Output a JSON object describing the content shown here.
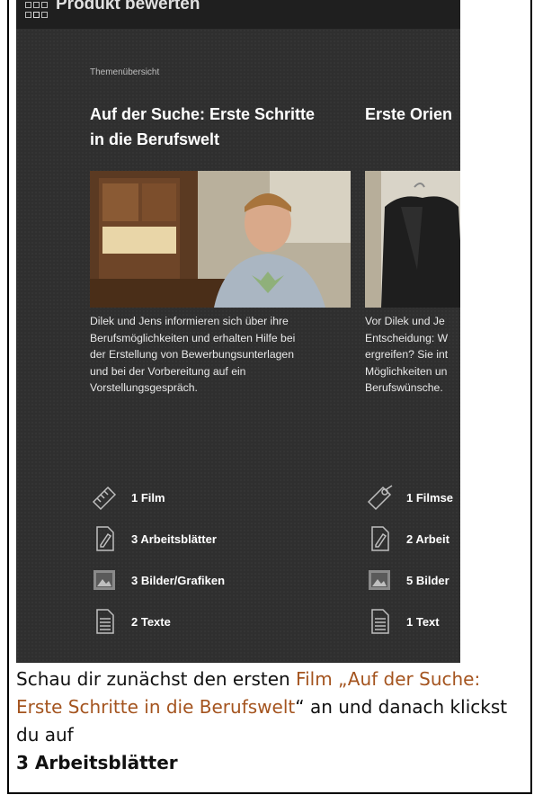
{
  "header": {
    "title": "Produkt bewerten"
  },
  "breadcrumb": "Themenübersicht",
  "columns": [
    {
      "title_line1": "Auf der Suche: Erste Schritte",
      "title_line2": "in die Berufswelt",
      "description_lines": [
        "Dilek und Jens informieren sich über ihre",
        "Berufsmöglichkeiten und erhalten Hilfe bei",
        "der Erstellung von Bewerbungsunterlagen",
        "und bei der Vorbereitung auf ein",
        "Vorstellungsgespräch."
      ],
      "features": [
        {
          "icon": "film-icon",
          "label": "1 Film"
        },
        {
          "icon": "worksheet-icon",
          "label": "3 Arbeitsblätter"
        },
        {
          "icon": "image-icon",
          "label": "3 Bilder/Grafiken"
        },
        {
          "icon": "text-document-icon",
          "label": "2 Texte"
        }
      ]
    },
    {
      "title_line1": "Erste Orien",
      "description_lines": [
        "Vor Dilek und Je",
        "Entscheidung: W",
        "ergreifen? Sie int",
        "Möglichkeiten un",
        "Berufswünsche."
      ],
      "features": [
        {
          "icon": "film-clip-icon",
          "label": "1 Filmse"
        },
        {
          "icon": "worksheet-icon",
          "label": "2 Arbeit"
        },
        {
          "icon": "image-icon",
          "label": "5 Bilder"
        },
        {
          "icon": "text-document-icon",
          "label": "1 Text"
        }
      ]
    }
  ],
  "caption": {
    "part1": "Schau dir zunächst den ersten ",
    "highlight": "Film „Auf der Suche: Erste Schritte in die Berufswelt",
    "part2": "“ an und danach klickst du auf",
    "emphasis": "3 Arbeitsblätter"
  },
  "colors": {
    "accent": "#a4541f",
    "page_bg": "#2f2f2f",
    "header_bg": "#1f1f1f"
  }
}
